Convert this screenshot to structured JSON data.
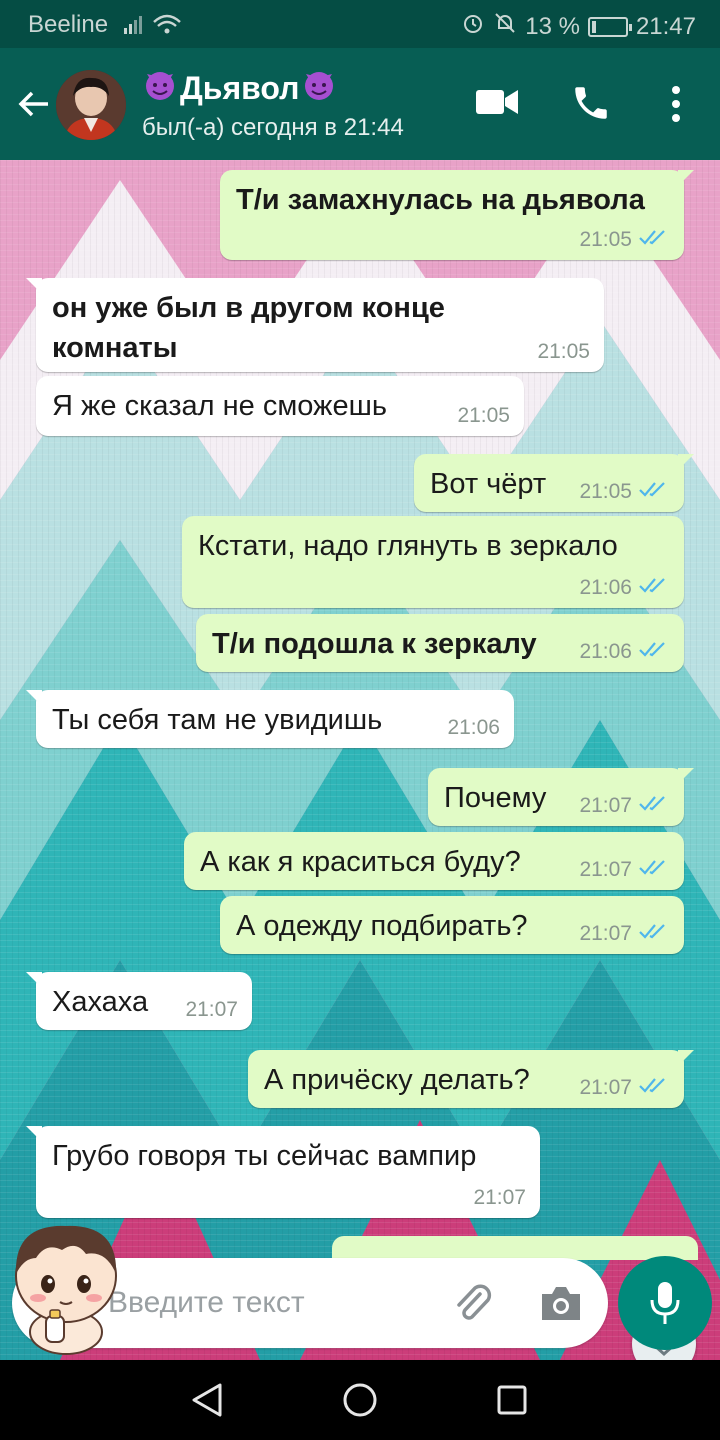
{
  "status_bar": {
    "carrier": "Beeline",
    "battery": "13 %",
    "battery_level": 0.13,
    "time": "21:47"
  },
  "header": {
    "name": "Дьявол",
    "last_seen": "был(-а) сегодня в 21:44",
    "icons": [
      "back-arrow-icon",
      "video-call-icon",
      "phone-icon",
      "more-vert-icon"
    ],
    "accent": "#075e54"
  },
  "messages": [
    {
      "dir": "out",
      "text": "Т/и замахнулась на дьявола",
      "time": "21:05",
      "bold": true
    },
    {
      "dir": "in",
      "line1": "он уже был в другом конце",
      "line2": "комнаты",
      "time": "21:05",
      "bold": true
    },
    {
      "dir": "in",
      "text": "Я же сказал не сможешь",
      "time": "21:05"
    },
    {
      "dir": "out",
      "text": "Вот чёрт",
      "time": "21:05"
    },
    {
      "dir": "out",
      "text": "Кстати, надо глянуть в зеркало",
      "time": "21:06"
    },
    {
      "dir": "out",
      "text": "Т/и подошла к зеркалу",
      "time": "21:06",
      "bold": true
    },
    {
      "dir": "in",
      "text": "Ты себя там не увидишь",
      "time": "21:06"
    },
    {
      "dir": "out",
      "text": "Почему",
      "time": "21:07"
    },
    {
      "dir": "out",
      "text": "А как я краситься буду?",
      "time": "21:07"
    },
    {
      "dir": "out",
      "text": "А одежду подбирать?",
      "time": "21:07"
    },
    {
      "dir": "in",
      "text": "Хахаха",
      "time": "21:07"
    },
    {
      "dir": "out",
      "text": "А причёску делать?",
      "time": "21:07"
    },
    {
      "dir": "in",
      "text": "Грубо говоря ты сейчас вампир",
      "time": "21:07"
    }
  ],
  "input": {
    "placeholder": "Введите текст"
  },
  "colors": {
    "outgoing_bubble": "#e1fbc6",
    "incoming_bubble": "#ffffff",
    "read_ticks": "#4fb6ec",
    "mic_button": "#00897b"
  }
}
